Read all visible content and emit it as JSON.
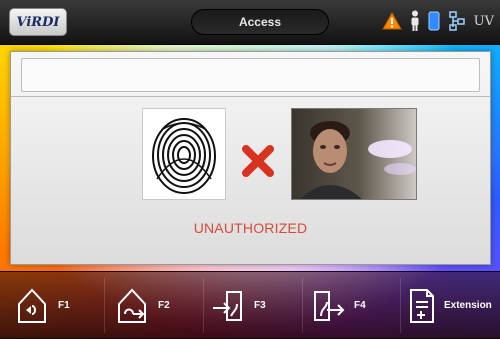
{
  "header": {
    "logo_text": "ViRDI",
    "title": "Access",
    "status_icons": [
      "warning-icon",
      "person-icon",
      "card-icon",
      "network-icon",
      "uv-label"
    ],
    "uv_text": "UV"
  },
  "result": {
    "status_text": "UNAUTHORIZED",
    "status_color": "#d54a3a"
  },
  "function_keys": [
    {
      "label": "F1",
      "icon": "door-enter-icon"
    },
    {
      "label": "F2",
      "icon": "door-exit-icon"
    },
    {
      "label": "F3",
      "icon": "enter-arrow-icon"
    },
    {
      "label": "F4",
      "icon": "exit-arrow-icon"
    },
    {
      "label": "Extension",
      "icon": "document-add-icon"
    }
  ]
}
